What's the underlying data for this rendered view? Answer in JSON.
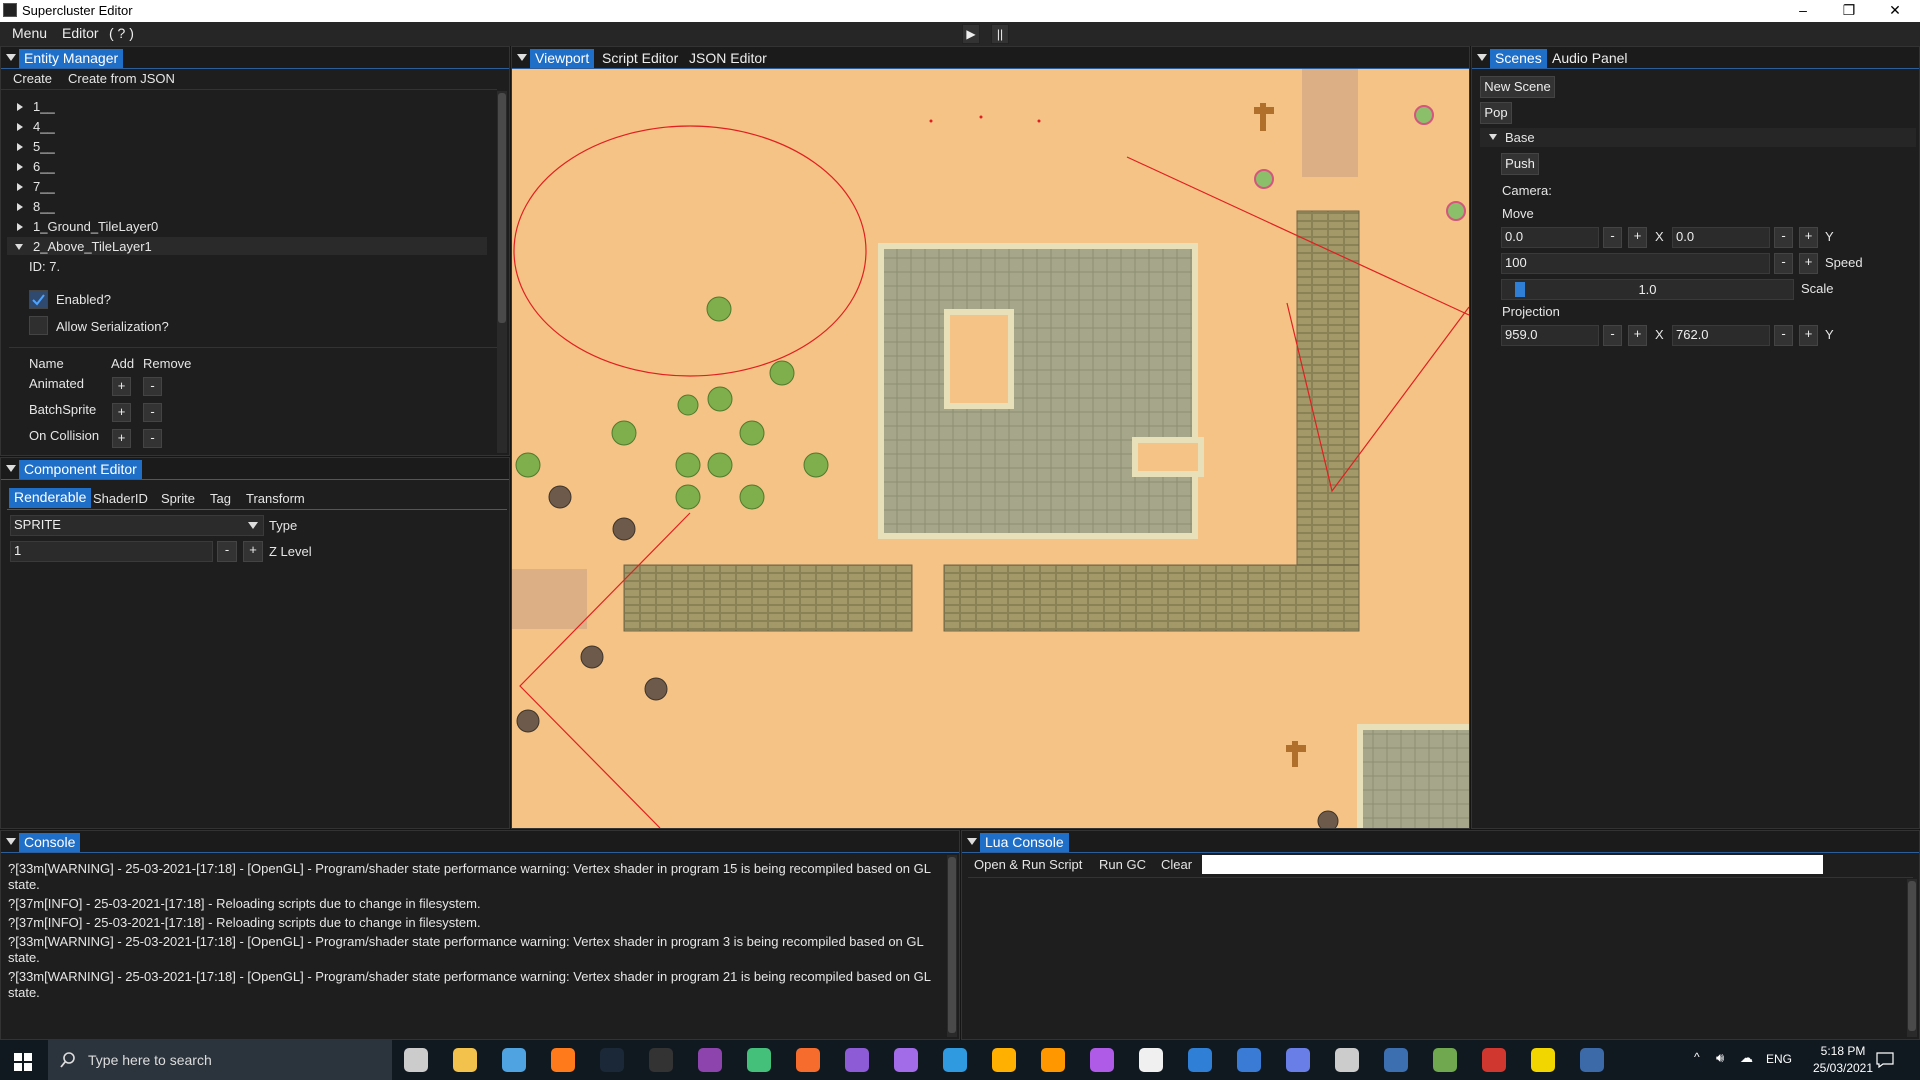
{
  "window": {
    "title": "Supercluster Editor",
    "controls": {
      "minimize": "–",
      "maximize": "❐",
      "close": "✕"
    }
  },
  "menubar": {
    "items": [
      "Menu",
      "Editor",
      "( ? )"
    ],
    "play": "▶",
    "pause": "||"
  },
  "entity_manager": {
    "tab": "Entity Manager",
    "actions": [
      "Create",
      "Create from JSON"
    ],
    "entities": [
      "1__",
      "4__",
      "5__",
      "6__",
      "7__",
      "8__",
      "1_Ground_TileLayer0",
      "2_Above_TileLayer1"
    ],
    "selected_id": "ID: 7.",
    "enabled_label": "Enabled?",
    "enabled": true,
    "serialization_label": "Allow Serialization?",
    "serialization": false,
    "columns": [
      "Name",
      "Add",
      "Remove"
    ],
    "components": [
      "Animated",
      "BatchSprite",
      "On Collision"
    ],
    "add_symbol": "+",
    "remove_symbol": "-"
  },
  "component_editor": {
    "tab": "Component Editor",
    "subtabs": [
      "Renderable",
      "ShaderID",
      "Sprite",
      "Tag",
      "Transform"
    ],
    "type_value": "SPRITE",
    "type_label": "Type",
    "z_value": "1",
    "z_label": "Z Level",
    "minus": "-",
    "plus": "+"
  },
  "center": {
    "tabs": [
      "Viewport",
      "Script Editor",
      "JSON Editor"
    ]
  },
  "scenes": {
    "tabs": [
      "Scenes",
      "Audio Panel"
    ],
    "new_scene": "New Scene",
    "pop": "Pop",
    "base": "Base",
    "push": "Push",
    "camera": "Camera:",
    "move": "Move",
    "move_x": "0.0",
    "move_y": "0.0",
    "speed_value": "100",
    "speed_label": "Speed",
    "scale_value": "1.0",
    "scale_label": "Scale",
    "scale_fraction": 0.04,
    "projection": "Projection",
    "proj_x": "959.0",
    "proj_y": "762.0",
    "x_label": "X",
    "y_label": "Y",
    "minus": "-",
    "plus": "+"
  },
  "console": {
    "tab": "Console",
    "lines": [
      "?[33m[WARNING] - 25-03-2021-[17:18] - [OpenGL] - Program/shader state performance warning: Vertex shader in program 15 is being recompiled based on GL state.",
      "?[37m[INFO] - 25-03-2021-[17:18] - Reloading scripts due to change in filesystem.",
      "?[37m[INFO] - 25-03-2021-[17:18] - Reloading scripts due to change in filesystem.",
      "?[33m[WARNING] - 25-03-2021-[17:18] - [OpenGL] - Program/shader state performance warning: Vertex shader in program 3 is being recompiled based on GL state.",
      "?[33m[WARNING] - 25-03-2021-[17:18] - [OpenGL] - Program/shader state performance warning: Vertex shader in program 21 is being recompiled based on GL state."
    ]
  },
  "lua_console": {
    "tab": "Lua Console",
    "actions": [
      "Open & Run Script",
      "Run GC",
      "Clear"
    ],
    "input": ""
  },
  "taskbar": {
    "search_placeholder": "Type here to search",
    "icons": [
      "task-view-icon",
      "file-explorer-icon",
      "wing-ide-icon",
      "firefox-icon",
      "steam-icon",
      "epic-games-icon",
      "obs-icon",
      "anaconda-icon",
      "origin-icon",
      "visual-studio-icon",
      "visual-studio-2-icon",
      "vscode-icon",
      "jetbrains-icon",
      "sublime-icon",
      "github-icon",
      "notepad-icon",
      "edge-icon",
      "trello-icon",
      "discord-icon",
      "unity-icon",
      "image-viewer-icon",
      "tree-app-icon",
      "popcorn-icon",
      "sticky-notes-icon",
      "editor-app-icon"
    ],
    "icon_colors": [
      "#cccccc",
      "#f3c24d",
      "#4fa3e0",
      "#ff7a1a",
      "#1b2838",
      "#333333",
      "#8e44ad",
      "#44c07a",
      "#f56c2d",
      "#8d5bd6",
      "#a26be8",
      "#2f9ae0",
      "#ffb000",
      "#ff9800",
      "#b05ae8",
      "#f0f0f0",
      "#2f7fd6",
      "#3a7bd5",
      "#6a7ee8",
      "#cccccc",
      "#3b6fb0",
      "#6fa84f",
      "#d0382f",
      "#f2d600",
      "#3c6aa8"
    ],
    "lang": "ENG",
    "time": "5:18 PM",
    "date": "25/03/2021"
  }
}
